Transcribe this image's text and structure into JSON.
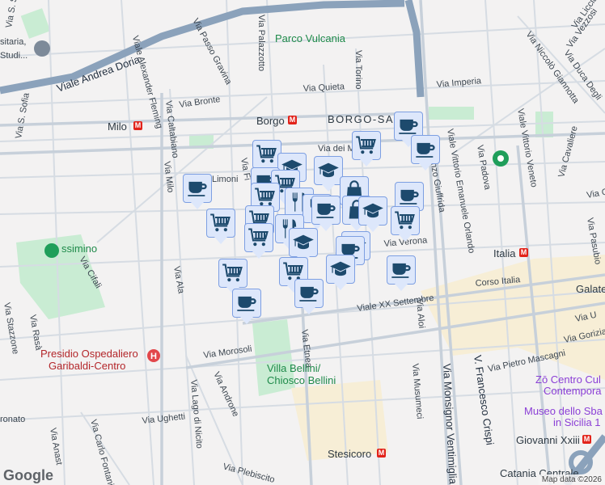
{
  "map": {
    "districts": {
      "borgo_san": "BORGO-SAN"
    },
    "places": {
      "parco_vulcania": "Parco Vulcania",
      "villa_bellini": "Villa Bellini/",
      "villa_bellini2": "Chiosco Bellini",
      "presidio": "Presidio Ospedaliero",
      "presidio2": "Garibaldi-Centro",
      "universitaria": "sitaria,",
      "universitaria2": "Studi...",
      "zo": "Zō Centro Cul",
      "zo2": "Contempora",
      "museo": "Museo dello Sba",
      "museo2": "in Sicilia 1",
      "ssimino": "ssimino"
    },
    "metro": {
      "borgo": "Borgo",
      "milo": "Milo",
      "italia": "Italia",
      "stesicoro": "Stesicoro",
      "giovanni": "Giovanni Xxiii",
      "catania_centrale": "Catania Centrale",
      "galatea": "Galate",
      "metro_icon": "M"
    },
    "streets": {
      "andrea_doria": "Viale Andrea Doria",
      "fleming": "Viale Alexander Fleming",
      "passo_gravina": "Via Passo Gravina",
      "palazzotto": "Via Palazzotto",
      "torino": "Via Torino",
      "quieta": "Via Quieta",
      "imperia": "Via Imperia",
      "bronte": "Via Bronte",
      "caltabiano": "Via Caltabiano",
      "milo": "Via Milo",
      "limoni": "Limoni",
      "dei_mille": "Via dei M",
      "giuffrida": "Vincenzo Giuffrida",
      "orlando": "Viale Vittorio Emanuele Orlando",
      "verona": "Via Verona",
      "corso_italia": "Corso Italia",
      "xx_settembre": "Viale XX Settembre",
      "ala": "Via Ala",
      "cifali": "Via Cifali",
      "morosoli": "Via Morosoli",
      "etnea": "Via Etnea",
      "aloi": "Via Aloi",
      "musumeci": "Via Musumeci",
      "ventimiglia": "Via Monsignor Ventimiglia",
      "crispi": "V. Francesco Crispi",
      "mascagni": "Via Pietro Mascagni",
      "gorizia": "Via Gorizia",
      "androne": "Via Androne",
      "lago_nicito": "Via Lago di Nicito",
      "ughetti": "Via Ughetti",
      "fontanini": "Via Carlo Fontanini",
      "plebiscito": "Via Plebiscito",
      "padova": "Via Padova",
      "vittorio_veneto": "Viale Vittorio Veneto",
      "cavaliere": "Via Cavaliere",
      "pasubio": "Via Pasubio",
      "giannotta": "Via Niccolò Giannotta",
      "duca": "Via Duca Degli",
      "vezzosi": "Via Vezzosi",
      "licciardello": "Via Licciar",
      "stazzone": "Via Stazzone",
      "rasa": "Via Rasà",
      "s_sofia": "Via S. Sofia",
      "s_s": "Via S. S",
      "gi": "Via Gi",
      "ur": "Via U",
      "anast": "Via Anast",
      "ronato": "ronato",
      "fi": "Via Fi",
      "d": "Via D"
    }
  },
  "icons": {
    "cup": "cafe",
    "cart": "grocery",
    "cap": "school",
    "bag": "shop",
    "fork": "restaurant"
  },
  "colors": {
    "marker_bg": "#dde7fb",
    "marker_border": "#7d9fe2",
    "icon": "#1d4a6d",
    "metro": "#e2231a",
    "park": "#c9ecd3"
  },
  "footer": {
    "logo": "Google",
    "attribution": "Map data ©2026"
  }
}
